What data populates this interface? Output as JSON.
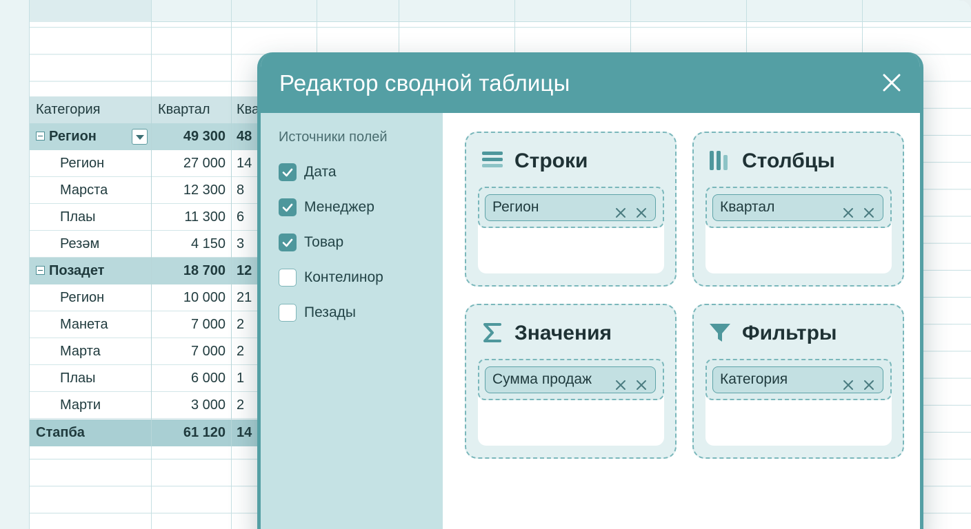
{
  "spreadsheet": {
    "pivot": {
      "headers": [
        "Категория",
        "Квартал",
        "Ква"
      ],
      "rows": [
        {
          "type": "group",
          "label": "Регион",
          "v1": "49 300",
          "v2": "48"
        },
        {
          "type": "child",
          "label": "Регион",
          "v1": "27 000",
          "v2": "14"
        },
        {
          "type": "child",
          "label": "Марста",
          "v1": "12 300",
          "v2": "8"
        },
        {
          "type": "child",
          "label": "Плаы",
          "v1": "11 300",
          "v2": "6"
        },
        {
          "type": "child",
          "label": "Резәм",
          "v1": "4 150",
          "v2": "3"
        },
        {
          "type": "group",
          "label": "Позадет",
          "v1": "18 700",
          "v2": "12"
        },
        {
          "type": "child",
          "label": "Регион",
          "v1": "10 000",
          "v2": "21"
        },
        {
          "type": "child",
          "label": "Манета",
          "v1": "7 000",
          "v2": "2"
        },
        {
          "type": "child",
          "label": "Марта",
          "v1": "7 000",
          "v2": "2"
        },
        {
          "type": "child",
          "label": "Плаы",
          "v1": "6 000",
          "v2": "1"
        },
        {
          "type": "child",
          "label": "Марти",
          "v1": "3 000",
          "v2": "2"
        },
        {
          "type": "total",
          "label": "Стапба",
          "v1": "61 120",
          "v2": "14"
        }
      ]
    }
  },
  "dialog": {
    "title": "Редактор сводной таблицы",
    "close_icon": "close-icon",
    "fields_title": "Источники полей",
    "fields": [
      {
        "label": "Дата",
        "checked": true
      },
      {
        "label": "Менеджер",
        "checked": true
      },
      {
        "label": "Товар",
        "checked": true
      },
      {
        "label": "Контелинор",
        "checked": false
      },
      {
        "label": "Пезады",
        "checked": false
      }
    ],
    "zones": {
      "rows": {
        "title": "Строки",
        "icon": "rows-icon",
        "chip": "Регион"
      },
      "columns": {
        "title": "Столбцы",
        "icon": "columns-icon",
        "chip": "Квартал"
      },
      "values": {
        "title": "Значения",
        "icon": "sigma-icon",
        "chip": "Сумма продаж"
      },
      "filters": {
        "title": "Фильтры",
        "icon": "filter-icon",
        "chip": "Категория"
      }
    }
  },
  "colors": {
    "accent": "#549fa4",
    "pane": "#c5e2e4",
    "zone_bg": "#e2f0f1",
    "chip_bg": "#c3e0e2"
  }
}
